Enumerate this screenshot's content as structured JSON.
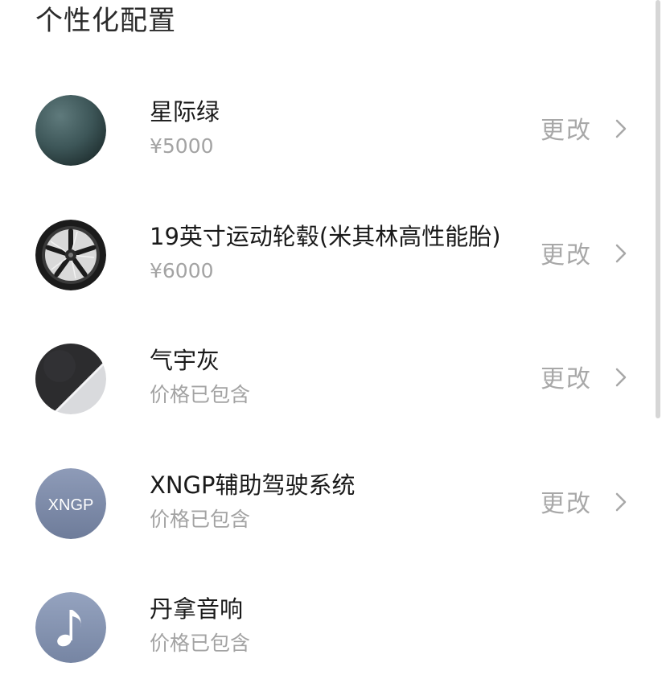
{
  "page_title": "个性化配置",
  "items": [
    {
      "name": "星际绿",
      "price": "¥5000",
      "action": "更改",
      "icon": "paint-color-swatch-icon"
    },
    {
      "name": "19英寸运动轮毂(米其林高性能胎)",
      "price": "¥6000",
      "action": "更改",
      "icon": "wheel-icon"
    },
    {
      "name": "气宇灰",
      "price": "价格已包含",
      "action": "更改",
      "icon": "interior-swatch-icon"
    },
    {
      "name": "XNGP辅助驾驶系统",
      "price": "价格已包含",
      "action": "更改",
      "icon": "xngp-badge-icon",
      "badge_text": "XNGP"
    },
    {
      "name": "丹拿音响",
      "price": "价格已包含",
      "icon": "music-note-icon"
    }
  ]
}
